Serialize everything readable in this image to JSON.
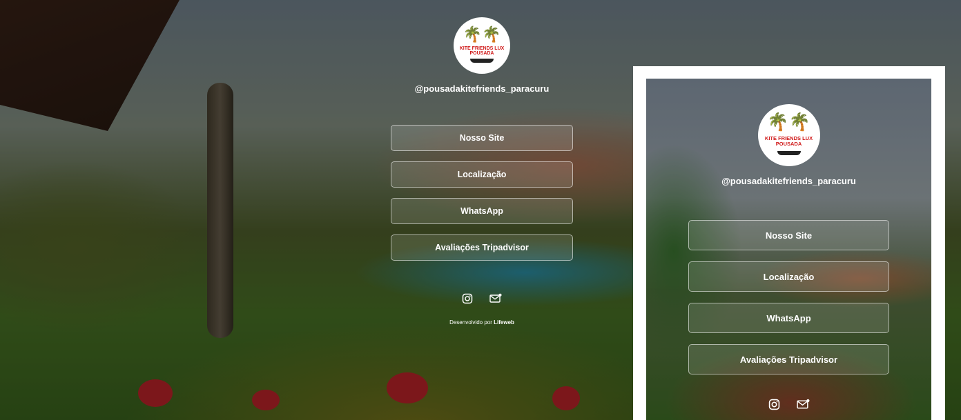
{
  "profile": {
    "logo_text": "KITE FRIENDS LUX POUSADA",
    "handle": "@pousadakitefriends_paracuru"
  },
  "links": [
    {
      "label": "Nosso Site"
    },
    {
      "label": "Localização"
    },
    {
      "label": "WhatsApp"
    },
    {
      "label": "Avaliações Tripadvisor"
    }
  ],
  "social": {
    "instagram_icon": "instagram-icon",
    "email_icon": "email-icon"
  },
  "footer": {
    "credit_prefix": "Desenvolvido por",
    "credit_brand": "Lifeweb"
  },
  "colors": {
    "button_border": "#ffffff",
    "text": "#ffffff",
    "logo_red": "#d01a1a"
  }
}
